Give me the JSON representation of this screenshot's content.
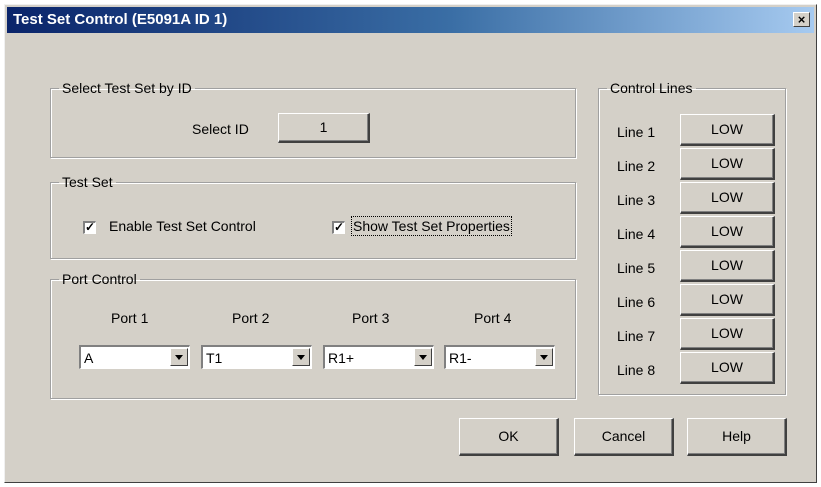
{
  "window": {
    "title": "Test Set Control (E5091A ID 1)",
    "close_glyph": "×"
  },
  "select_group": {
    "legend": "Select Test Set by ID",
    "label": "Select ID",
    "value": "1"
  },
  "testset_group": {
    "legend": "Test Set",
    "enable_label": "Enable Test Set Control",
    "enable_checked": true,
    "show_label": "Show Test Set Properties",
    "show_checked": true,
    "check_glyph": "✓"
  },
  "port_group": {
    "legend": "Port Control",
    "ports": [
      {
        "label": "Port 1",
        "value": "A"
      },
      {
        "label": "Port 2",
        "value": "T1"
      },
      {
        "label": "Port 3",
        "value": "R1+"
      },
      {
        "label": "Port 4",
        "value": "R1-"
      }
    ]
  },
  "control_lines": {
    "legend": "Control Lines",
    "lines": [
      {
        "label": "Line 1",
        "state": "LOW"
      },
      {
        "label": "Line 2",
        "state": "LOW"
      },
      {
        "label": "Line 3",
        "state": "LOW"
      },
      {
        "label": "Line 4",
        "state": "LOW"
      },
      {
        "label": "Line 5",
        "state": "LOW"
      },
      {
        "label": "Line 6",
        "state": "LOW"
      },
      {
        "label": "Line 7",
        "state": "LOW"
      },
      {
        "label": "Line 8",
        "state": "LOW"
      }
    ]
  },
  "buttons": {
    "ok": "OK",
    "cancel": "Cancel",
    "help": "Help"
  }
}
